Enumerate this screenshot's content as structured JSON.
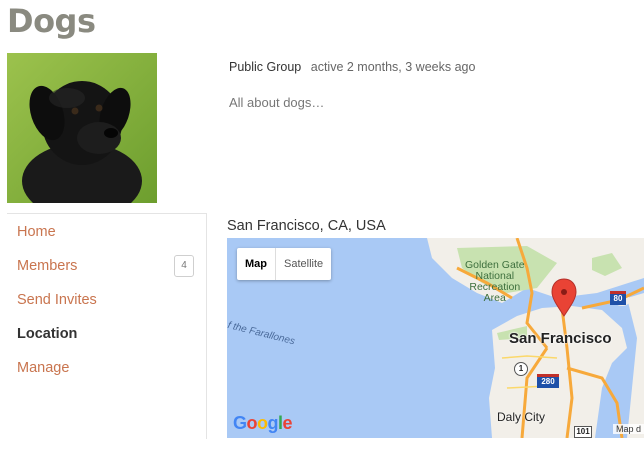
{
  "group": {
    "title": "Dogs",
    "type": "Public Group",
    "active": "active 2 months, 3 weeks ago",
    "description": "All about dogs…"
  },
  "nav": {
    "items": [
      {
        "label": "Home"
      },
      {
        "label": "Members",
        "badge": "4"
      },
      {
        "label": "Send Invites"
      },
      {
        "label": "Location"
      },
      {
        "label": "Manage"
      }
    ],
    "active_index": 3
  },
  "location": {
    "label": "San Francisco, CA, USA"
  },
  "map": {
    "toggle": {
      "map": "Map",
      "satellite": "Satellite",
      "selected": "Map"
    },
    "labels": {
      "park": [
        "Golden Gate",
        "National",
        "Recreation",
        "Area"
      ],
      "sea": "f the Farallones",
      "city": "San Francisco",
      "daly": "Daly City"
    },
    "shields": {
      "i80": "80",
      "i280": "280",
      "r1": "1",
      "us101": "101"
    },
    "logo": "Google",
    "attribution": "Map d",
    "colors": {
      "water": "#a9c9f5",
      "land": "#f2efe9",
      "park": "#c8e2b0",
      "highway": "#f7a93b",
      "marker": "#e94335"
    }
  },
  "accent": "#c9754f"
}
